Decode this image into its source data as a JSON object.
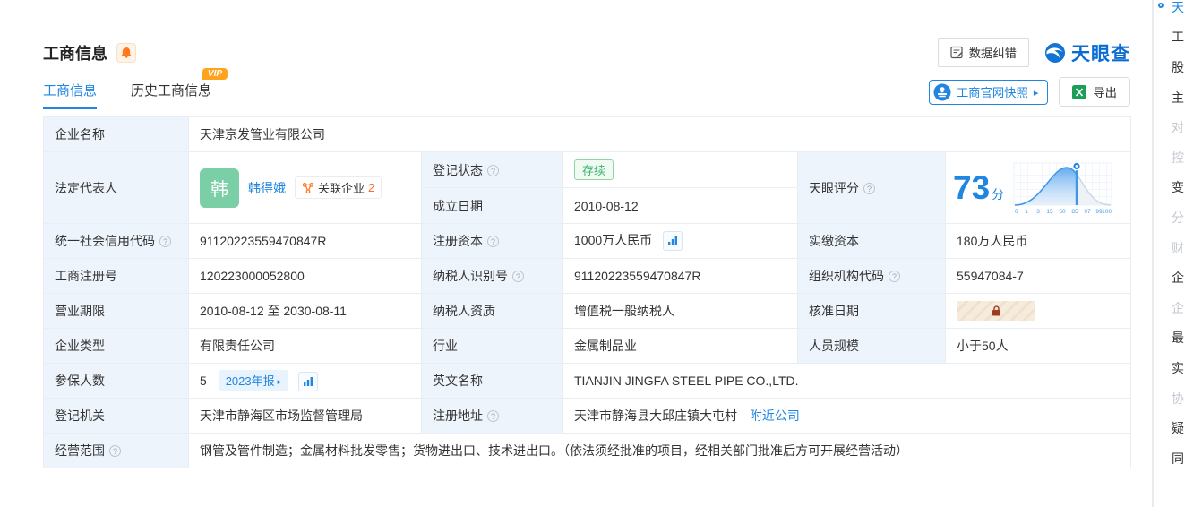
{
  "header": {
    "title": "工商信息",
    "data_correction": "数据纠错",
    "logo_text": "天眼查"
  },
  "tabs": {
    "business": "工商信息",
    "history": "历史工商信息",
    "vip": "VIP"
  },
  "toolbar": {
    "snapshot": "工商官网快照",
    "export": "导出"
  },
  "fields": {
    "company_name": {
      "label": "企业名称",
      "value": "天津京发管业有限公司"
    },
    "legal_rep": {
      "label": "法定代表人",
      "avatar": "韩",
      "name": "韩得娥",
      "related_label": "关联企业",
      "related_count": "2"
    },
    "reg_status": {
      "label": "登记状态",
      "value": "存续"
    },
    "establish_date": {
      "label": "成立日期",
      "value": "2010-08-12"
    },
    "credit_code": {
      "label": "统一社会信用代码",
      "value": "91120223559470847R"
    },
    "reg_capital": {
      "label": "注册资本",
      "value": "1000万人民币"
    },
    "paid_capital": {
      "label": "实缴资本",
      "value": "180万人民币"
    },
    "reg_number": {
      "label": "工商注册号",
      "value": "120223000052800"
    },
    "taxpayer_id": {
      "label": "纳税人识别号",
      "value": "91120223559470847R"
    },
    "org_code": {
      "label": "组织机构代码",
      "value": "55947084-7"
    },
    "business_term": {
      "label": "营业期限",
      "value": "2010-08-12 至 2030-08-11"
    },
    "taxpayer_quality": {
      "label": "纳税人资质",
      "value": "增值税一般纳税人"
    },
    "approval_date": {
      "label": "核准日期"
    },
    "company_type": {
      "label": "企业类型",
      "value": "有限责任公司"
    },
    "industry": {
      "label": "行业",
      "value": "金属制品业"
    },
    "staff_size": {
      "label": "人员规模",
      "value": "小于50人"
    },
    "insured_count": {
      "label": "参保人数",
      "value": "5",
      "report_tag": "2023年报"
    },
    "english_name": {
      "label": "英文名称",
      "value": "TIANJIN JINGFA STEEL PIPE CO.,LTD."
    },
    "reg_authority": {
      "label": "登记机关",
      "value": "天津市静海区市场监督管理局"
    },
    "reg_address": {
      "label": "注册地址",
      "value": "天津市静海县大邱庄镇大屯村",
      "nearby": "附近公司"
    },
    "business_scope": {
      "label": "经营范围",
      "value": "钢管及管件制造；金属材料批发零售；货物进出口、技术进出口。（依法须经批准的项目，经相关部门批准后方可开展经营活动）"
    }
  },
  "score": {
    "label": "天眼评分",
    "value": "73",
    "unit": "分"
  },
  "chart_data": {
    "type": "area",
    "title": "天眼评分分布曲线",
    "score_marker": 73,
    "x_ticks": [
      "0",
      "1",
      "3",
      "15",
      "50",
      "85",
      "97",
      "99",
      "100"
    ]
  },
  "sidebar": {
    "items": [
      {
        "char": "天",
        "state": "active"
      },
      {
        "char": "工",
        "state": "normal"
      },
      {
        "char": "股",
        "state": "normal"
      },
      {
        "char": "主",
        "state": "normal"
      },
      {
        "char": "对",
        "state": "disabled"
      },
      {
        "char": "控",
        "state": "disabled"
      },
      {
        "char": "变",
        "state": "normal"
      },
      {
        "char": "分",
        "state": "disabled"
      },
      {
        "char": "财",
        "state": "disabled"
      },
      {
        "char": "企",
        "state": "normal"
      },
      {
        "char": "企",
        "state": "disabled"
      },
      {
        "char": "最",
        "state": "normal"
      },
      {
        "char": "实",
        "state": "normal"
      },
      {
        "char": "协",
        "state": "disabled"
      },
      {
        "char": "疑",
        "state": "normal"
      },
      {
        "char": "同",
        "state": "normal"
      }
    ]
  },
  "colors": {
    "accent_blue": "#2186e0",
    "logo_blue": "#0b6cd4",
    "tag_green": "#3cb371",
    "avatar_green": "#7bcfa6",
    "orange": "#ff7a1f",
    "lock_red": "#a03a20"
  }
}
